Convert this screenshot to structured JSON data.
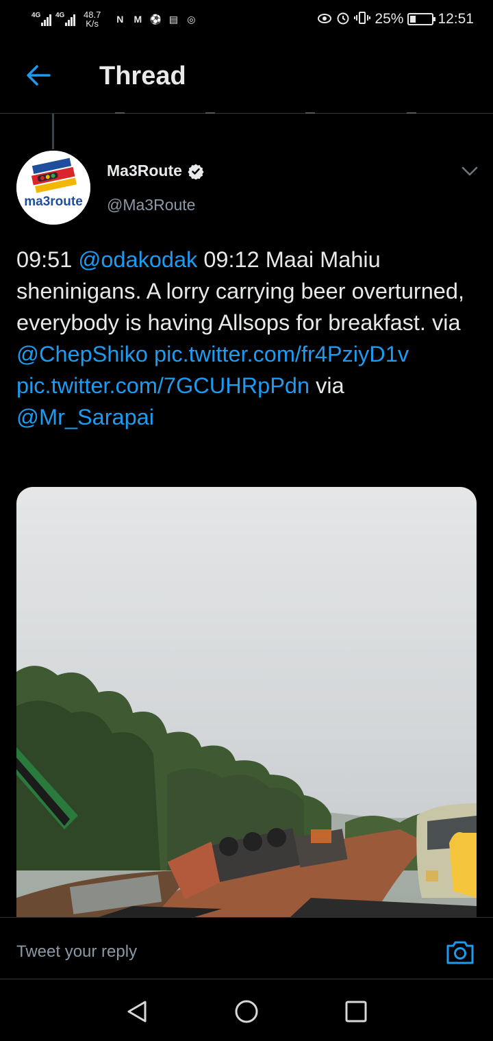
{
  "status_bar": {
    "signal_1_label": "4G",
    "signal_2_label": "4G",
    "net_speed_value": "48.7",
    "net_speed_unit": "K/s",
    "battery_percent": "25%",
    "battery_level": 0.25,
    "time": "12:51",
    "notification_icons": [
      "N",
      "M",
      "⚽",
      "▤",
      "◎"
    ]
  },
  "header": {
    "title": "Thread"
  },
  "tweet": {
    "author_name": "Ma3Route",
    "author_handle": "@Ma3Route",
    "avatar_logo_text": "ma3route",
    "text_segments": [
      {
        "text": "09:51 ",
        "link": false
      },
      {
        "text": "@odakodak",
        "link": true
      },
      {
        "text": " 09:12 Maai Mahiu sheninigans. A lorry carrying beer overturned, everybody is having Allsops for breakfast.   via ",
        "link": false
      },
      {
        "text": "@ChepShiko",
        "link": true
      },
      {
        "text": "  ",
        "link": false
      },
      {
        "text": "pic.twitter.com/fr4PziyD1v",
        "link": true
      },
      {
        "text": " ",
        "link": false
      },
      {
        "text": "pic.twitter.com/7GCUHRpPdn",
        "link": true
      },
      {
        "text": " via ",
        "link": false
      },
      {
        "text": "@Mr_Sarapai",
        "link": true
      }
    ]
  },
  "reply": {
    "placeholder": "Tweet your reply"
  },
  "colors": {
    "background": "#000000",
    "link": "#1d9bf0",
    "text": "#e7e9ea",
    "secondary_text": "#8b98a5",
    "divider": "#2f3336"
  },
  "icons": {
    "back": "arrow-left-icon",
    "verified": "verified-badge-icon",
    "chevron": "chevron-down-icon",
    "camera": "camera-icon",
    "nav_back": "triangle-back-icon",
    "nav_home": "circle-home-icon",
    "nav_recents": "square-recents-icon"
  }
}
